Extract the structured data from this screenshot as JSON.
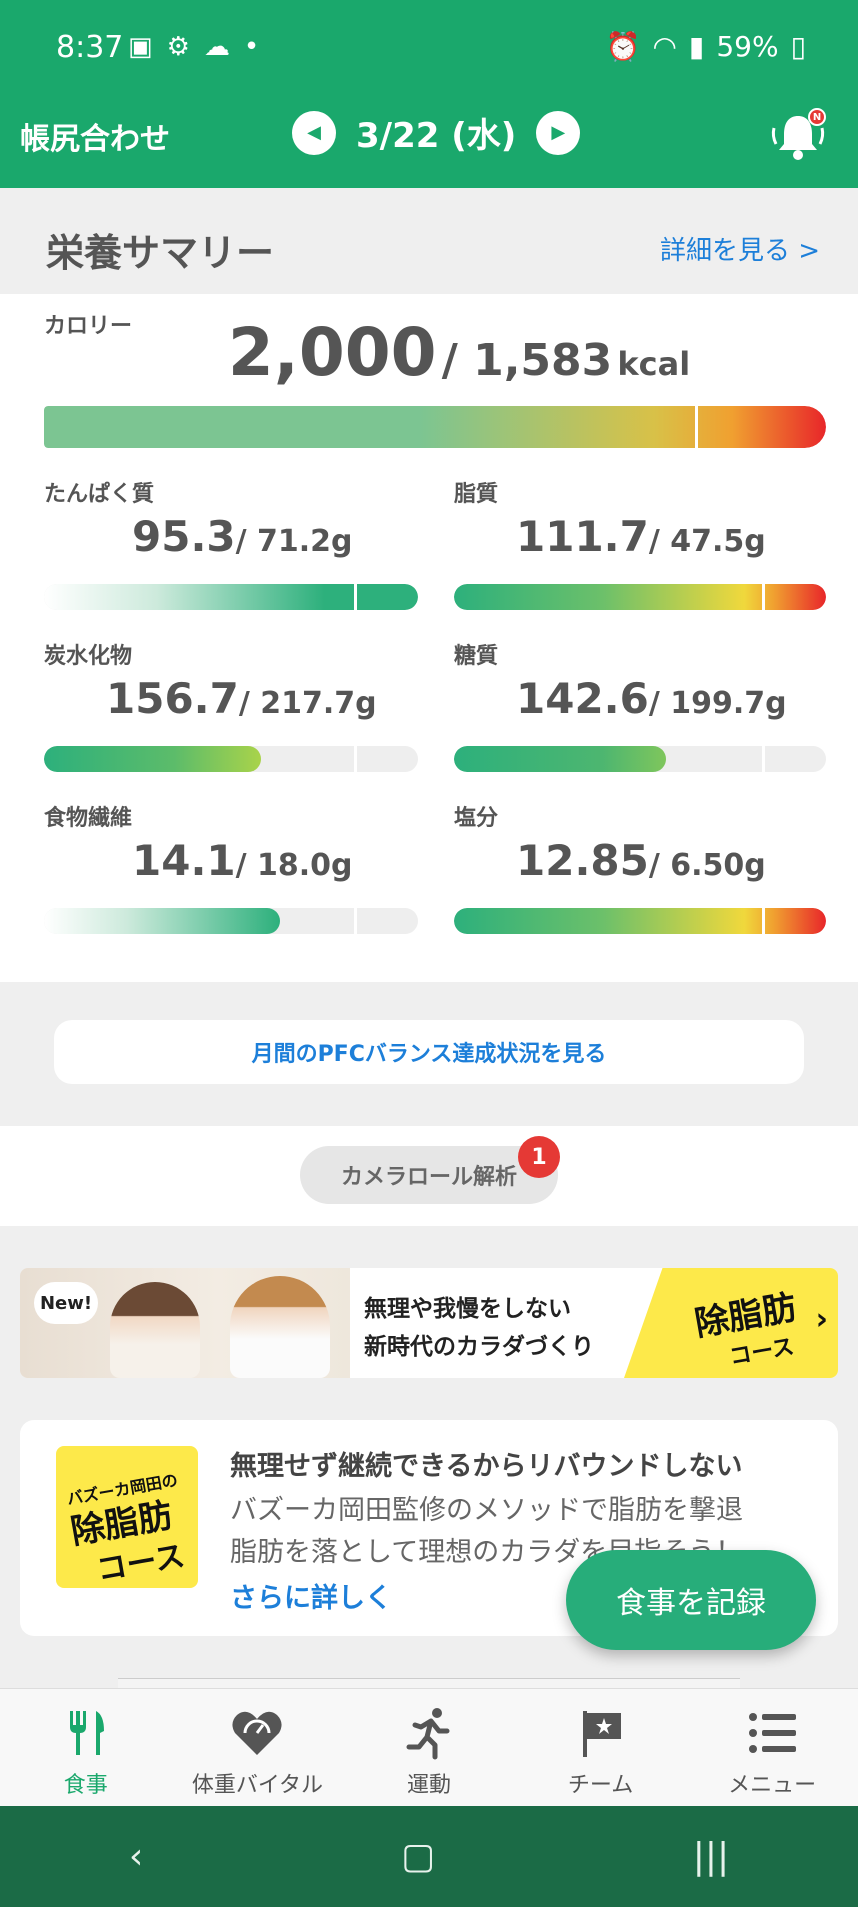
{
  "status": {
    "time": "8:37",
    "battery": "59%"
  },
  "header": {
    "title": "帳尻合わせ",
    "date": "3/22 (水)",
    "notif_badge": "N"
  },
  "summary": {
    "title": "栄養サマリー",
    "more_link": "詳細を見る >"
  },
  "calorie": {
    "label": "カロリー",
    "value": "2,000",
    "target": "/ 1,583",
    "unit": "kcal"
  },
  "nutrients": [
    {
      "label": "たんぱく質",
      "value": "95.3",
      "target": "/ 71.2g"
    },
    {
      "label": "脂質",
      "value": "111.7",
      "target": "/ 47.5g"
    },
    {
      "label": "炭水化物",
      "value": "156.7",
      "target": "/ 217.7g"
    },
    {
      "label": "糖質",
      "value": "142.6",
      "target": "/ 199.7g"
    },
    {
      "label": "食物繊維",
      "value": "14.1",
      "target": "/ 18.0g"
    },
    {
      "label": "塩分",
      "value": "12.85",
      "target": "/ 6.50g"
    }
  ],
  "pfc_button": "月間のPFCバランス達成状況を見る",
  "camera": {
    "label": "カメラロール解析",
    "badge": "1"
  },
  "banner": {
    "new": "New!",
    "line1": "無理や我慢をしない",
    "line2": "新時代のカラダづくり",
    "course_main": "除脂肪",
    "course_sub": "コース"
  },
  "card": {
    "logo_top": "バズーカ岡田の",
    "logo_main": "除脂肪",
    "logo_sub": "コース",
    "heading": "無理せず継続できるからリバウンドしない",
    "line1": "バズーカ岡田監修のメソッドで脂肪を撃退",
    "line2": "脂肪を落として理想のカラダを目指そう！",
    "link": "さらに詳しく"
  },
  "fab": "食事を記録",
  "tabs": [
    {
      "label": "食事",
      "icon": "fork-knife-icon",
      "active": true
    },
    {
      "label": "体重バイタル",
      "icon": "heart-gauge-icon",
      "active": false
    },
    {
      "label": "運動",
      "icon": "runner-icon",
      "active": false
    },
    {
      "label": "チーム",
      "icon": "flag-icon",
      "active": false
    },
    {
      "label": "メニュー",
      "icon": "list-icon",
      "active": false
    }
  ],
  "colors": {
    "brand": "#1aa86c",
    "link": "#1d7fd9",
    "alert": "#e53935",
    "navbar": "#1b6b46"
  }
}
